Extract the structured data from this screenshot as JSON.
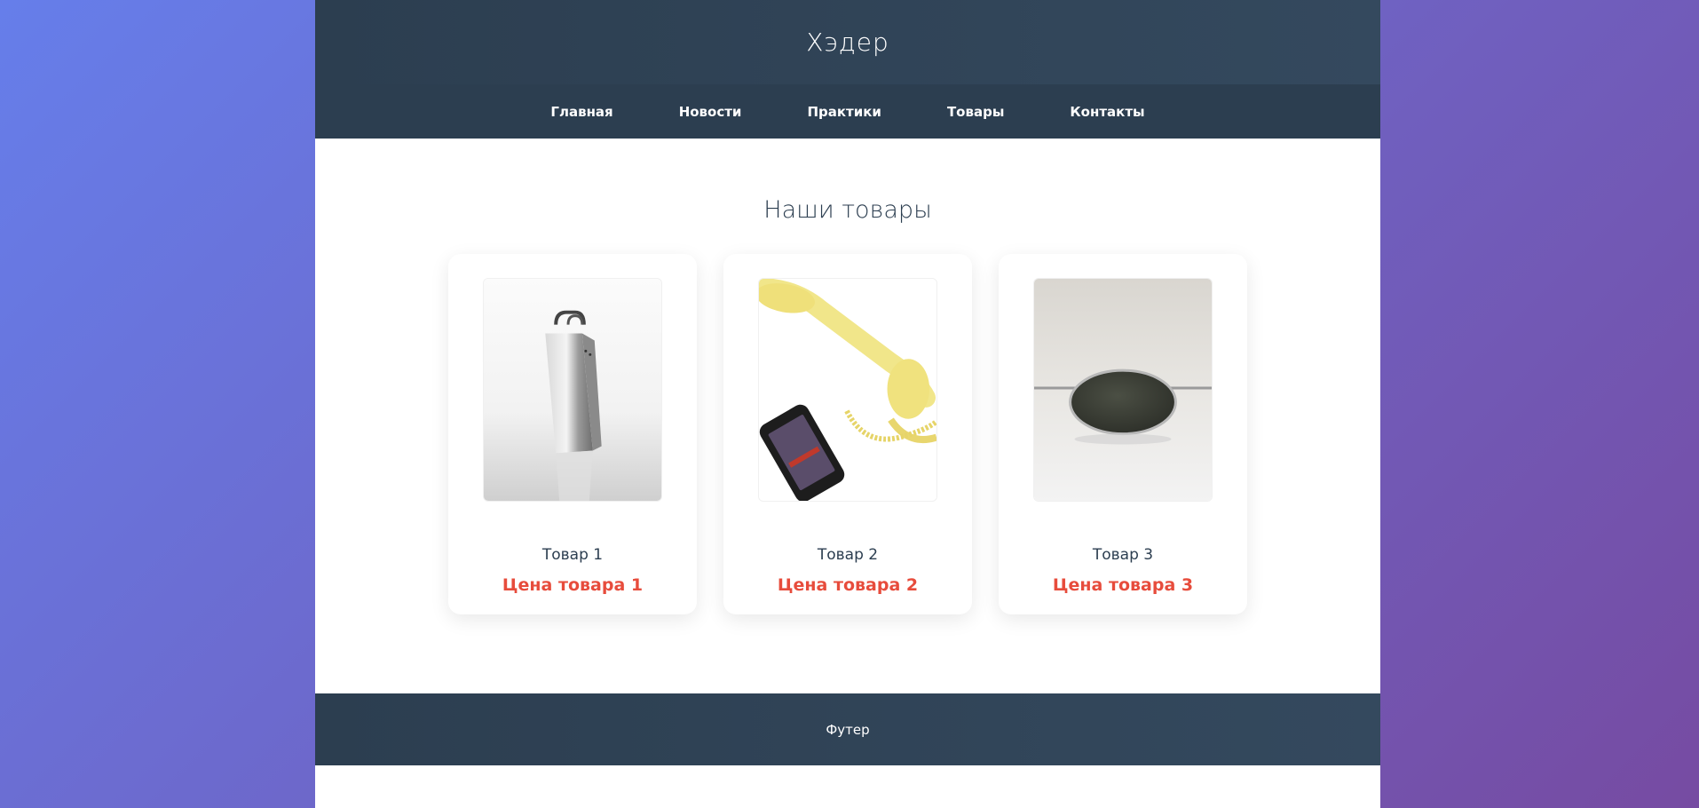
{
  "header": {
    "title": "Хэдер"
  },
  "nav": {
    "items": [
      {
        "label": "Главная"
      },
      {
        "label": "Новости"
      },
      {
        "label": "Практики"
      },
      {
        "label": "Товары"
      },
      {
        "label": "Контакты"
      }
    ]
  },
  "main": {
    "title": "Наши товары",
    "products": [
      {
        "name": "Товар 1",
        "price": "Цена товара 1",
        "image": "grater-image"
      },
      {
        "name": "Товар 2",
        "price": "Цена товара 2",
        "image": "phone-handset-image"
      },
      {
        "name": "Товар 3",
        "price": "Цена товара 3",
        "image": "sunglasses-image"
      }
    ]
  },
  "footer": {
    "text": "Футер"
  },
  "colors": {
    "header_bg": "#2c3e50",
    "price": "#e74c3c",
    "gradient_start": "#667eea",
    "gradient_end": "#764ba2"
  }
}
